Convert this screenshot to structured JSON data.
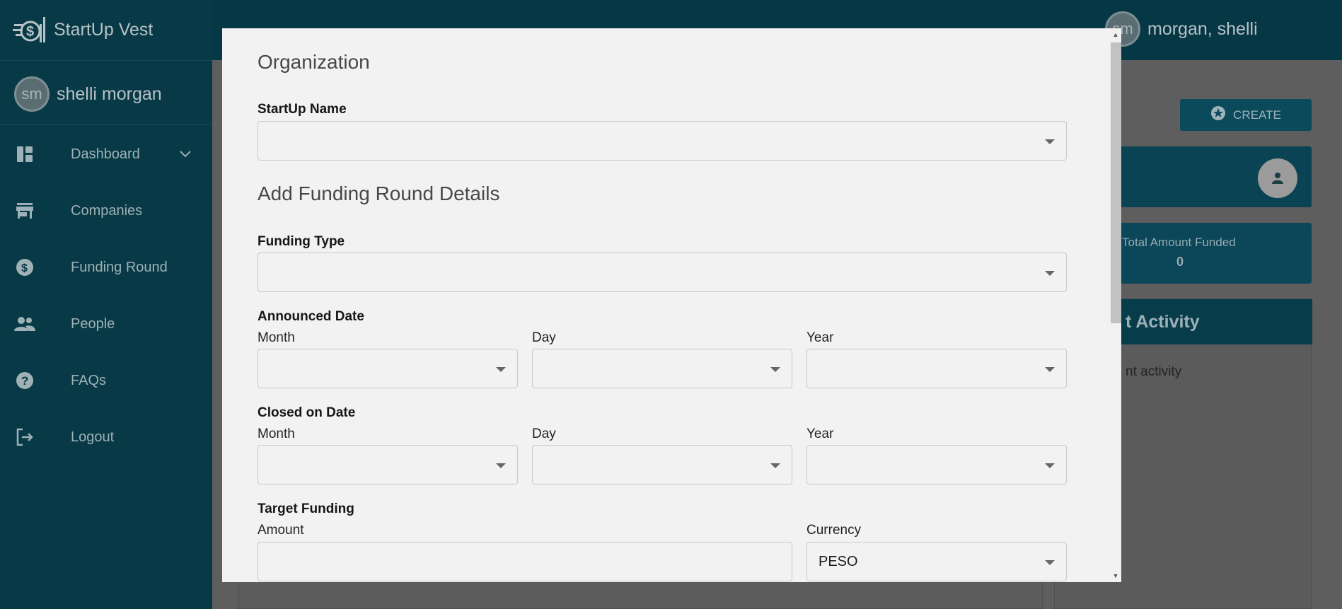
{
  "app": {
    "brand": "StartUp Vest",
    "top_user": {
      "initials": "sm",
      "name": "morgan, shelli"
    }
  },
  "sidebar": {
    "user": {
      "initials": "sm",
      "name": "shelli morgan"
    },
    "items": [
      {
        "label": "Dashboard",
        "icon": "dashboard-icon",
        "expandable": true
      },
      {
        "label": "Companies",
        "icon": "store-icon"
      },
      {
        "label": "Funding Round",
        "icon": "dollar-circle-icon"
      },
      {
        "label": "People",
        "icon": "people-icon"
      },
      {
        "label": "FAQs",
        "icon": "help-circle-icon"
      },
      {
        "label": "Logout",
        "icon": "logout-icon"
      }
    ]
  },
  "dashboard": {
    "create_label": "CREATE",
    "total_amount_label": "Total Amount Funded",
    "total_amount_value": "0",
    "activity_title": "t Activity",
    "activity_text": "nt activity"
  },
  "modal": {
    "section_org": "Organization",
    "startup_name_label": "StartUp Name",
    "startup_name_value": "",
    "section_funding": "Add Funding Round Details",
    "funding_type_label": "Funding Type",
    "funding_type_value": "",
    "announced_label": "Announced Date",
    "closed_label": "Closed on Date",
    "month_label": "Month",
    "day_label": "Day",
    "year_label": "Year",
    "target_label": "Target Funding",
    "amount_label": "Amount",
    "amount_value": "",
    "currency_label": "Currency",
    "currency_value": "PESO"
  }
}
